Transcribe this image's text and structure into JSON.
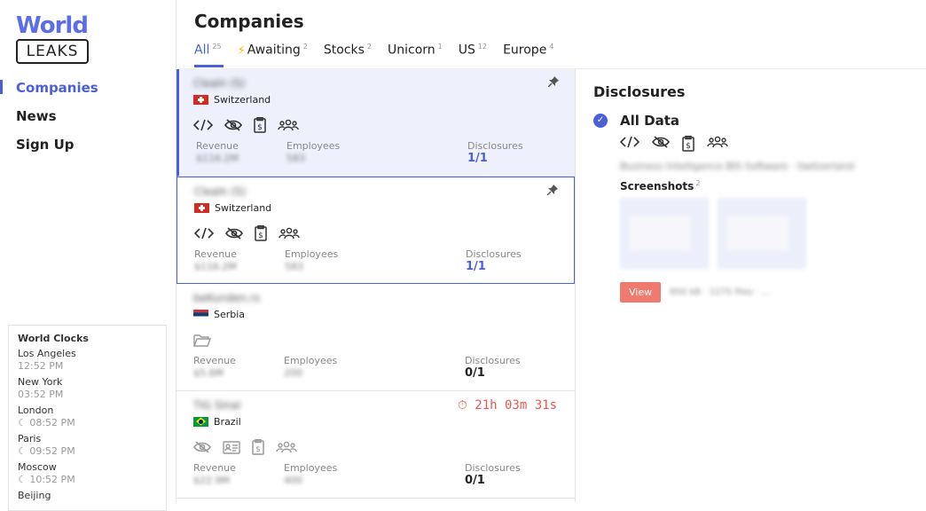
{
  "logo": {
    "top": "World",
    "bottom": "LEAKS"
  },
  "nav": [
    {
      "label": "Companies",
      "active": true
    },
    {
      "label": "News",
      "active": false
    },
    {
      "label": "Sign Up",
      "active": false
    }
  ],
  "clocks": {
    "title": "World Clocks",
    "items": [
      {
        "city": "Los Angeles",
        "time": "12:52 PM"
      },
      {
        "city": "New York",
        "time": "03:52 PM"
      },
      {
        "city": "London",
        "time": "☾ 08:52 PM"
      },
      {
        "city": "Paris",
        "time": "☾ 09:52 PM"
      },
      {
        "city": "Moscow",
        "time": "☾ 10:52 PM"
      },
      {
        "city": "Beijing",
        "time": ""
      }
    ]
  },
  "header": {
    "title": "Companies",
    "tabs": [
      {
        "label": "All",
        "count": "25",
        "active": true
      },
      {
        "label": "Awaiting",
        "count": "2",
        "icon": "lightning-icon"
      },
      {
        "label": "Stocks",
        "count": "2"
      },
      {
        "label": "Unicorn",
        "count": "1"
      },
      {
        "label": "US",
        "count": "12"
      },
      {
        "label": "Europe",
        "count": "4"
      }
    ]
  },
  "companies": [
    {
      "name": "Clealn (S)",
      "country": "Switzerland",
      "revenue_label": "Revenue",
      "revenue": "$116.2M",
      "employees_label": "Employees",
      "employees": "583",
      "disclosures_label": "Disclosures",
      "disclosures": "1/1",
      "pinned": true
    },
    {
      "name": "Clealn (S)",
      "country": "Switzerland",
      "revenue_label": "Revenue",
      "revenue": "$116.2M",
      "employees_label": "Employees",
      "employees": "583",
      "disclosures_label": "Disclosures",
      "disclosures": "1/1",
      "pinned": true
    },
    {
      "name": "beKunden.rs",
      "country": "Serbia",
      "revenue_label": "Revenue",
      "revenue": "$5.6M",
      "employees_label": "Employees",
      "employees": "200",
      "disclosures_label": "Disclosures",
      "disclosures": "0/1"
    },
    {
      "name": "TIG Sinal",
      "country": "Brazil",
      "revenue_label": "Revenue",
      "revenue": "$22.9M",
      "employees_label": "Employees",
      "employees": "400",
      "disclosures_label": "Disclosures",
      "disclosures": "0/1",
      "timer": "21h 03m 31s"
    }
  ],
  "detail": {
    "title": "Disclosures",
    "item_label": "All Data",
    "blurred_desc": "Business Intelligence BIS Software · Switzerland",
    "screenshots_label": "Screenshots",
    "screenshots_count": "2",
    "view_button": "View",
    "view_meta": "850 kB · 1275 files · ...",
    "colors": {
      "accent": "#4a5fd8",
      "danger": "#e4584f",
      "view_button": "#ef7a6e"
    }
  }
}
